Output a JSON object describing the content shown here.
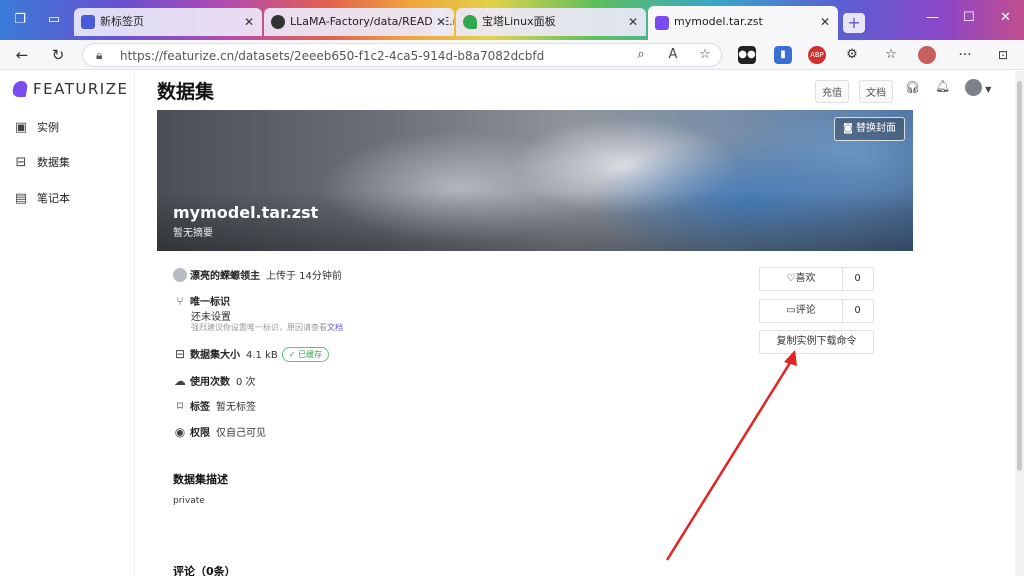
{
  "browser": {
    "tabs": [
      {
        "title": "新标签页"
      },
      {
        "title": "LLaMA-Factory/data/README.md"
      },
      {
        "title": "宝塔Linux面板"
      },
      {
        "title": "mymodel.tar.zst"
      }
    ],
    "url": "https://featurize.cn/datasets/2eeeb650-f1c2-4ca5-914d-b8a7082dcbfd",
    "accent": "#7a4cf0"
  },
  "sidebar": {
    "logo": "FEATURIZE",
    "items": [
      {
        "label": "实例",
        "icon": "monitor-icon"
      },
      {
        "label": "数据集",
        "icon": "archive-icon"
      },
      {
        "label": "笔记本",
        "icon": "notebook-icon"
      }
    ]
  },
  "header": {
    "recharge": "充值",
    "docs": "文档"
  },
  "page": {
    "title": "数据集",
    "dataset": {
      "name": "mymodel.tar.zst",
      "summary": "暂无摘要",
      "change_cover": "替换封面",
      "owner": "漂亮的蝾螈领主",
      "uploaded": "上传于 14分钟前",
      "uid_label": "唯一标识",
      "uid_value": "还未设置",
      "uid_hint": "强烈建议你设置唯一标识，原因请查看",
      "uid_hint_link": "文档",
      "size_label": "数据集大小",
      "size_value": "4.1 kB",
      "cached_badge": "✓ 已缓存",
      "uses_label": "使用次数",
      "uses_value": "0 次",
      "tags_label": "标签",
      "tags_value": "暂无标签",
      "perm_label": "权限",
      "perm_value": "仅自己可见",
      "like_label": "喜欢",
      "like_count": "0",
      "comment_label": "评论",
      "comment_count": "0",
      "copy_cmd": "复制实例下载命令",
      "desc_title": "数据集描述",
      "desc_text": "private",
      "comments_title": "评论（0条）"
    }
  }
}
